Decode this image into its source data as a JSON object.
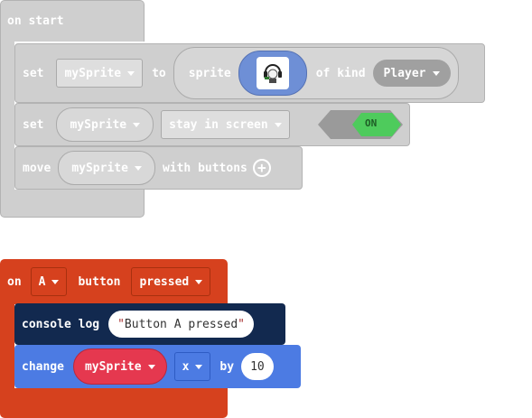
{
  "on_start": {
    "label": "on start",
    "set_sprite": {
      "set": "set",
      "variable": "mySprite",
      "to": "to",
      "sprite": "sprite",
      "of_kind": "of kind",
      "kind": "Player"
    },
    "stay_in_screen": {
      "set": "set",
      "variable": "mySprite",
      "property": "stay in screen",
      "toggle": "ON"
    },
    "move": {
      "move": "move",
      "variable": "mySprite",
      "with_buttons": "with buttons"
    }
  },
  "on_button": {
    "on": "on",
    "button": "A",
    "button_label": "button",
    "event": "pressed",
    "console_log": {
      "label": "console log",
      "value": "Button A pressed"
    },
    "change": {
      "change": "change",
      "variable": "mySprite",
      "property": "x",
      "by": "by",
      "amount": "10"
    }
  },
  "colors": {
    "disabled_block": "#cfcfcf",
    "controller_event": "#d6411e",
    "console": "#12294f",
    "sprites": "#4c7be3",
    "variable": "#e5384f",
    "toggle_on": "#4ecb5c"
  },
  "icons": [
    "caret-down-icon",
    "sprite-avatar-icon",
    "add-circle-icon"
  ]
}
